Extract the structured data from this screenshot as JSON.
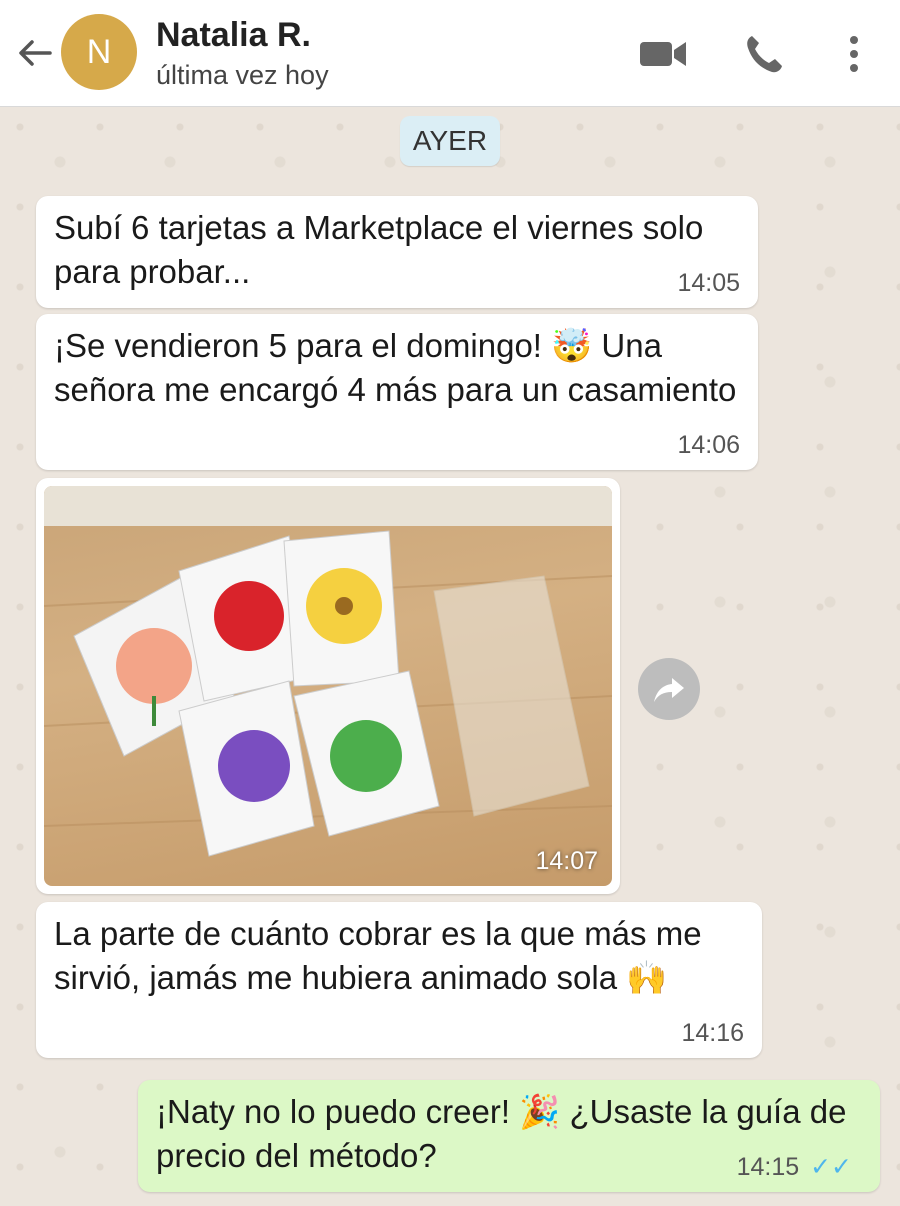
{
  "header": {
    "avatar_letter": "N",
    "name": "Natalia R.",
    "status": "última vez hoy"
  },
  "day_chip": "AYER",
  "messages": [
    {
      "text": "Subí 6 tarjetas a Marketplace el viernes solo para probar...",
      "time": "14:05",
      "from": "contact"
    },
    {
      "text": "¡Se vendieron 5 para el domingo! 🤯 Una señora me encargó 4 más para un casamiento",
      "time": "14:06",
      "from": "contact"
    },
    {
      "type": "image",
      "time": "14:07",
      "from": "contact"
    },
    {
      "text": "La parte de cuánto cobrar es la que más me sirvió, jamás me hubiera animado sola 🙌",
      "time": "14:16",
      "from": "contact"
    },
    {
      "text": "¡Naty no lo puedo creer! 🎉 ¿Usaste la guía de precio del método?",
      "time": "14:15",
      "from": "me",
      "ticks": "✓✓"
    }
  ],
  "colors": {
    "outgoing_bubble": "#dcf8c6",
    "incoming_bubble": "#ffffff",
    "read_ticks": "#4fb6ec",
    "avatar": "#d6a94a"
  }
}
